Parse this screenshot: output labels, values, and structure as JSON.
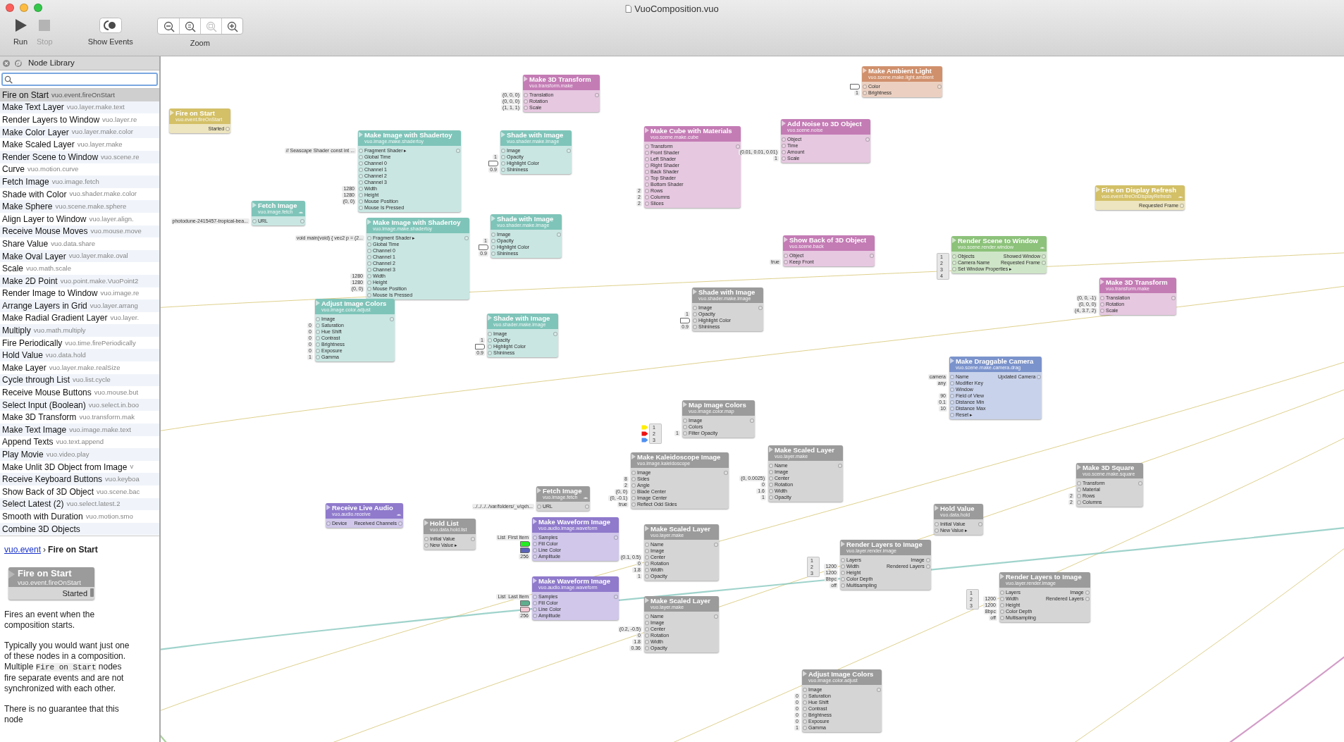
{
  "window": {
    "title": "VuoComposition.vuo"
  },
  "toolbar": {
    "buttons": [
      {
        "kind": "run",
        "label": "Run",
        "disabled": false
      },
      {
        "kind": "stop",
        "label": "Stop",
        "disabled": true
      },
      {
        "kind": "events",
        "label": "Show Events",
        "disabled": false
      }
    ],
    "zoom": {
      "label": "Zoom",
      "buttons": [
        {
          "kind": "out",
          "disabled": false
        },
        {
          "kind": "actual",
          "disabled": false
        },
        {
          "kind": "fit",
          "disabled": true
        },
        {
          "kind": "in",
          "disabled": false
        }
      ]
    }
  },
  "sidebar": {
    "title": "Node Library",
    "items": [
      {
        "name": "Fire on Start",
        "class": "vuo.event.fireOnStart",
        "selected": true
      },
      {
        "name": "Make Text Layer",
        "class": "vuo.layer.make.text",
        "selected": false
      },
      {
        "name": "Render Layers to Window",
        "class": "vuo.layer.re",
        "selected": false
      },
      {
        "name": "Make Color Layer",
        "class": "vuo.layer.make.color",
        "selected": false
      },
      {
        "name": "Make Scaled Layer",
        "class": "vuo.layer.make",
        "selected": false
      },
      {
        "name": "Render Scene to Window",
        "class": "vuo.scene.re",
        "selected": false
      },
      {
        "name": "Curve",
        "class": "vuo.motion.curve",
        "selected": false
      },
      {
        "name": "Fetch Image",
        "class": "vuo.image.fetch",
        "selected": false
      },
      {
        "name": "Shade with Color",
        "class": "vuo.shader.make.color",
        "selected": false
      },
      {
        "name": "Make Sphere",
        "class": "vuo.scene.make.sphere",
        "selected": false
      },
      {
        "name": "Align Layer to Window",
        "class": "vuo.layer.align.",
        "selected": false
      },
      {
        "name": "Receive Mouse Moves",
        "class": "vuo.mouse.move",
        "selected": false
      },
      {
        "name": "Share Value",
        "class": "vuo.data.share",
        "selected": false
      },
      {
        "name": "Make Oval Layer",
        "class": "vuo.layer.make.oval",
        "selected": false
      },
      {
        "name": "Scale",
        "class": "vuo.math.scale",
        "selected": false
      },
      {
        "name": "Make 2D Point",
        "class": "vuo.point.make.VuoPoint2",
        "selected": false
      },
      {
        "name": "Render Image to Window",
        "class": "vuo.image.re",
        "selected": false
      },
      {
        "name": "Arrange Layers in Grid",
        "class": "vuo.layer.arrang",
        "selected": false
      },
      {
        "name": "Make Radial Gradient Layer",
        "class": "vuo.layer.",
        "selected": false
      },
      {
        "name": "Multiply",
        "class": "vuo.math.multiply",
        "selected": false
      },
      {
        "name": "Fire Periodically",
        "class": "vuo.time.firePeriodically",
        "selected": false
      },
      {
        "name": "Hold Value",
        "class": "vuo.data.hold",
        "selected": false
      },
      {
        "name": "Make Layer",
        "class": "vuo.layer.make.realSize",
        "selected": false
      },
      {
        "name": "Cycle through List",
        "class": "vuo.list.cycle",
        "selected": false
      },
      {
        "name": "Receive Mouse Buttons",
        "class": "vuo.mouse.but",
        "selected": false
      },
      {
        "name": "Select Input (Boolean)",
        "class": "vuo.select.in.boo",
        "selected": false
      },
      {
        "name": "Make 3D Transform",
        "class": "vuo.transform.mak",
        "selected": false
      },
      {
        "name": "Make Text Image",
        "class": "vuo.image.make.text",
        "selected": false
      },
      {
        "name": "Append Texts",
        "class": "vuo.text.append",
        "selected": false
      },
      {
        "name": "Play Movie",
        "class": "vuo.video.play",
        "selected": false
      },
      {
        "name": "Make Unlit 3D Object from Image",
        "class": "v",
        "selected": false
      },
      {
        "name": "Receive Keyboard Buttons",
        "class": "vuo.keyboa",
        "selected": false
      },
      {
        "name": "Show Back of 3D Object",
        "class": "vuo.scene.bac",
        "selected": false
      },
      {
        "name": "Select Latest (2)",
        "class": "vuo.select.latest.2",
        "selected": false
      },
      {
        "name": "Smooth with Duration",
        "class": "vuo.motion.smo",
        "selected": false
      },
      {
        "name": "Combine 3D Objects",
        "selected": false
      }
    ]
  },
  "documentation": {
    "link": "vuo.event",
    "separator": "›",
    "current": "Fire on Start",
    "node": {
      "title": "Fire on Start",
      "class": "vuo.event.fireOnStart",
      "output": "Started"
    },
    "paragraphs": [
      [
        {
          "kind": "text",
          "text": "Fires an event when the composition starts."
        }
      ],
      [
        {
          "kind": "text",
          "text": "Typically you would want just one of these nodes in a composition. Multiple "
        },
        {
          "kind": "code",
          "text": "Fire on Start"
        },
        {
          "kind": "text",
          "text": " nodes fire separate events and are not synchronized with each other."
        }
      ],
      [
        {
          "kind": "text",
          "text": "There is no guarantee that this node"
        }
      ]
    ]
  },
  "canvas": {
    "nodes": [
      {
        "title": "Fire on Start",
        "class": "vuo.event.fireOnStart",
        "color": "#d3c067",
        "outputs": [
          "Started"
        ]
      },
      {
        "title": "Make 3D Transform",
        "class": "vuo.transform.make",
        "color": "#c47cb5",
        "inputs": [
          {
            "label": "Translation",
            "value": "(0, 0, 0)"
          },
          {
            "label": "Rotation",
            "value": "(0, 0, 0)"
          },
          {
            "label": "Scale",
            "value": "(1, 1, 1)"
          }
        ]
      },
      {
        "title": "Make Image with Shadertoy",
        "class": "vuo.image.make.shadertoy",
        "color": "#7fc4b9",
        "inputs": [
          {
            "label": "Fragment Shader ▸",
            "value": "// Seascape Shader const int ..."
          },
          {
            "label": "Global Time"
          },
          {
            "label": "Channel 0"
          },
          {
            "label": "Channel 1"
          },
          {
            "label": "Channel 2"
          },
          {
            "label": "Channel 3"
          },
          {
            "label": "Width",
            "value": "1280"
          },
          {
            "label": "Height",
            "value": "1280"
          },
          {
            "label": "Mouse Position",
            "value": "(0, 0)"
          },
          {
            "label": "Mouse Is Pressed"
          }
        ]
      },
      {
        "title": "Shade with Image",
        "class": "vuo.shader.make.image",
        "color": "#7fc4b9",
        "inputs": [
          {
            "label": "Image"
          },
          {
            "label": "Opacity",
            "value": "1"
          },
          {
            "label": "Highlight Color",
            "color": "#ffffff"
          },
          {
            "label": "Shininess",
            "value": "0.9"
          }
        ]
      },
      {
        "title": "Fetch Image",
        "class": "vuo.image.fetch",
        "color": "#7fc4b9",
        "fires": true,
        "inputs": [
          {
            "label": "URL",
            "value": "photodune-2415457-tropical-bea..."
          }
        ]
      },
      {
        "title": "Make Image with Shadertoy",
        "class": "vuo.image.make.shadertoy",
        "color": "#7fc4b9",
        "inputs": [
          {
            "label": "Fragment Shader ▸",
            "value": "void main(void) { vec2 p = (2..."
          },
          {
            "label": "Global Time"
          },
          {
            "label": "Channel 0"
          },
          {
            "label": "Channel 1"
          },
          {
            "label": "Channel 2"
          },
          {
            "label": "Channel 3"
          },
          {
            "label": "Width",
            "value": "1280"
          },
          {
            "label": "Height",
            "value": "1280"
          },
          {
            "label": "Mouse Position",
            "value": "(0, 0)"
          },
          {
            "label": "Mouse Is Pressed"
          }
        ]
      },
      {
        "title": "Shade with Image",
        "class": "vuo.shader.make.image",
        "color": "#7fc4b9",
        "inputs": [
          {
            "label": "Image"
          },
          {
            "label": "Opacity",
            "value": "1"
          },
          {
            "label": "Highlight Color",
            "color": "#ffffff"
          },
          {
            "label": "Shininess",
            "value": "0.9"
          }
        ]
      },
      {
        "title": "Adjust Image Colors",
        "class": "vuo.image.color.adjust",
        "color": "#7fc4b9",
        "inputs": [
          {
            "label": "Image"
          },
          {
            "label": "Saturation",
            "value": "0"
          },
          {
            "label": "Hue Shift",
            "value": "0"
          },
          {
            "label": "Contrast",
            "value": "0"
          },
          {
            "label": "Brightness",
            "value": "0"
          },
          {
            "label": "Exposure",
            "value": "0"
          },
          {
            "label": "Gamma",
            "value": "1"
          }
        ]
      },
      {
        "title": "Shade with Image",
        "class": "vuo.shader.make.image",
        "color": "#7fc4b9",
        "inputs": [
          {
            "label": "Image"
          },
          {
            "label": "Opacity",
            "value": "1"
          },
          {
            "label": "Highlight Color",
            "color": "#ffffff"
          },
          {
            "label": "Shininess",
            "value": "0.9"
          }
        ]
      },
      {
        "title": "Make Ambient Light",
        "class": "vuo.scene.make.light.ambient",
        "color": "#d0906c",
        "inputs": [
          {
            "label": "Color",
            "color": "#ffffff"
          },
          {
            "label": "Brightness",
            "value": "1"
          }
        ]
      },
      {
        "title": "Make Cube with Materials",
        "class": "vuo.scene.make.cube",
        "color": "#c47cb5",
        "inputs": [
          {
            "label": "Transform"
          },
          {
            "label": "Front Shader"
          },
          {
            "label": "Left Shader"
          },
          {
            "label": "Right Shader"
          },
          {
            "label": "Back Shader"
          },
          {
            "label": "Top Shader"
          },
          {
            "label": "Bottom Shader"
          },
          {
            "label": "Rows",
            "value": "2"
          },
          {
            "label": "Columns",
            "value": "2"
          },
          {
            "label": "Slices",
            "value": "2"
          }
        ]
      },
      {
        "title": "Add Noise to 3D Object",
        "class": "vuo.scene.noise",
        "color": "#c47cb5",
        "inputs": [
          {
            "label": "Object"
          },
          {
            "label": "Time"
          },
          {
            "label": "Amount",
            "value": "(0.01, 0.01, 0.01)"
          },
          {
            "label": "Scale",
            "value": "1"
          }
        ]
      },
      {
        "title": "Fire on Display Refresh",
        "class": "vuo.event.fireOnDisplayRefresh",
        "color": "#d3c067",
        "fires": true,
        "outputs": [
          "Requested Frame"
        ]
      },
      {
        "title": "Show Back of 3D Object",
        "class": "vuo.scene.back",
        "color": "#c47cb5",
        "inputs": [
          {
            "label": "Object"
          },
          {
            "label": "Keep Front",
            "value": "true"
          }
        ]
      },
      {
        "title": "Render Scene to Window",
        "class": "vuo.scene.render.window",
        "color": "#8cc27a",
        "fires": true,
        "inputs": [
          {
            "label": "Objects",
            "list": [
              {
                "label": "1"
              },
              {
                "label": "2"
              },
              {
                "label": "3"
              },
              {
                "label": "4"
              }
            ]
          },
          {
            "label": "Camera Name"
          },
          {
            "label": "Set Window Properties ▸"
          }
        ],
        "outputs": [
          "Showed Window",
          "Requested Frame"
        ]
      },
      {
        "title": "Make 3D Transform",
        "class": "vuo.transform.make",
        "color": "#c47cb5",
        "inputs": [
          {
            "label": "Translation",
            "value": "(0, 0, -1)"
          },
          {
            "label": "Rotation",
            "value": "(0, 0, 0)"
          },
          {
            "label": "Scale",
            "value": "(4, 3.7, 2)"
          }
        ]
      },
      {
        "title": "Shade with Image",
        "class": "vuo.shader.make.image",
        "color": "#9b9b9b",
        "inputs": [
          {
            "label": "Image"
          },
          {
            "label": "Opacity",
            "value": "1"
          },
          {
            "label": "Highlight Color",
            "color": "#ffffff"
          },
          {
            "label": "Shininess",
            "value": "0.9"
          }
        ]
      },
      {
        "title": "Make Draggable Camera",
        "class": "vuo.scene.make.camera.drag",
        "color": "#7b93cc",
        "inputs": [
          {
            "label": "Name",
            "value": "camera"
          },
          {
            "label": "Modifier Key",
            "value": "any"
          },
          {
            "label": "Window"
          },
          {
            "label": "Field of View",
            "value": "90"
          },
          {
            "label": "Distance Min",
            "value": "0.1"
          },
          {
            "label": "Distance Max",
            "value": "10"
          },
          {
            "label": "Reset ▸"
          }
        ],
        "outputs": [
          "Updated Camera"
        ]
      },
      {
        "title": "Map Image Colors",
        "class": "vuo.image.color.map",
        "color": "#9b9b9b",
        "inputs": [
          {
            "label": "Image"
          },
          {
            "label": "Colors",
            "list": [
              {
                "label": "1",
                "color": "#ffee00"
              },
              {
                "label": "2",
                "color": "#ee1111"
              },
              {
                "label": "3",
                "color": "#4f8ff0"
              }
            ]
          },
          {
            "label": "Filter Opacity",
            "value": "1"
          }
        ]
      },
      {
        "title": "Make Kaleidoscope Image",
        "class": "vuo.image.kaleidoscope",
        "color": "#9b9b9b",
        "inputs": [
          {
            "label": "Image"
          },
          {
            "label": "Sides",
            "value": "8"
          },
          {
            "label": "Angle",
            "value": "2"
          },
          {
            "label": "Blade Center",
            "value": "(0, 0)"
          },
          {
            "label": "Image Center",
            "value": "(0, -0.1)"
          },
          {
            "label": "Reflect Odd Sides",
            "value": "true"
          }
        ]
      },
      {
        "title": "Make Scaled Layer",
        "class": "vuo.layer.make",
        "color": "#9b9b9b",
        "inputs": [
          {
            "label": "Name"
          },
          {
            "label": "Image"
          },
          {
            "label": "Center",
            "value": "(0, 0.0025)"
          },
          {
            "label": "Rotation",
            "value": "0"
          },
          {
            "label": "Width",
            "value": "1.6"
          },
          {
            "label": "Opacity",
            "value": "1"
          }
        ]
      },
      {
        "title": "Make 3D Square",
        "class": "vuo.scene.make.square",
        "color": "#9b9b9b",
        "inputs": [
          {
            "label": "Transform"
          },
          {
            "label": "Material"
          },
          {
            "label": "Rows",
            "value": "2"
          },
          {
            "label": "Columns",
            "value": "2"
          }
        ]
      },
      {
        "title": "Receive Live Audio",
        "class": "vuo.audio.receive",
        "color": "#8f7acc",
        "fires": true,
        "inputs": [
          {
            "label": "Device"
          }
        ],
        "outputs": [
          "Received Channels"
        ]
      },
      {
        "title": "Fetch Image",
        "class": "vuo.image.fetch",
        "color": "#9b9b9b",
        "fires": true,
        "inputs": [
          {
            "label": "URL",
            "value": "../../../../var/folders/_v/qxh..."
          }
        ]
      },
      {
        "title": "Hold List",
        "class": "vuo.data.hold.list",
        "color": "#9b9b9b",
        "inputs": [
          {
            "label": "Initial Value"
          },
          {
            "label": "New Value ▸"
          }
        ]
      },
      {
        "title": "Make Waveform Image",
        "class": "vuo.audio.image.waveform",
        "color": "#8f7acc",
        "inputs": [
          {
            "label": "Samples",
            "value": "List  First Item"
          },
          {
            "label": "Fill Color",
            "color": "#22ee22"
          },
          {
            "label": "Line Color",
            "color": "#5a63b8"
          },
          {
            "label": "Amplitude",
            "value": "256"
          }
        ]
      },
      {
        "title": "Make Scaled Layer",
        "class": "vuo.layer.make",
        "color": "#9b9b9b",
        "inputs": [
          {
            "label": "Name"
          },
          {
            "label": "Image"
          },
          {
            "label": "Center",
            "value": "(0.1, 0.5)"
          },
          {
            "label": "Rotation",
            "value": "0"
          },
          {
            "label": "Width",
            "value": "1.8"
          },
          {
            "label": "Opacity",
            "value": "1"
          }
        ]
      },
      {
        "title": "Hold Value",
        "class": "vuo.data.hold",
        "color": "#9b9b9b",
        "inputs": [
          {
            "label": "Initial Value"
          },
          {
            "label": "New Value ▸"
          }
        ]
      },
      {
        "title": "Render Layers to Image",
        "class": "vuo.layer.render.image",
        "color": "#9b9b9b",
        "inputs": [
          {
            "label": "Layers",
            "list": [
              {
                "label": "1"
              },
              {
                "label": "2"
              },
              {
                "label": "3"
              }
            ]
          },
          {
            "label": "Width",
            "value": "1200"
          },
          {
            "label": "Height",
            "value": "1200"
          },
          {
            "label": "Color Depth",
            "value": "8bpc"
          },
          {
            "label": "Multisampling",
            "value": "off"
          }
        ],
        "outputs": [
          "Image",
          "Rendered Layers"
        ]
      },
      {
        "title": "Make Waveform Image",
        "class": "vuo.audio.image.waveform",
        "color": "#8f7acc",
        "inputs": [
          {
            "label": "Samples",
            "value": "List  Last Item"
          },
          {
            "label": "Fill Color",
            "color": "#5fae8e"
          },
          {
            "label": "Line Color",
            "color": "#f4c9d4"
          },
          {
            "label": "Amplitude",
            "value": "256"
          }
        ]
      },
      {
        "title": "Render Layers to Image",
        "class": "vuo.layer.render.image",
        "color": "#9b9b9b",
        "inputs": [
          {
            "label": "Layers",
            "list": [
              {
                "label": "1"
              },
              {
                "label": "2"
              },
              {
                "label": "3"
              }
            ]
          },
          {
            "label": "Width",
            "value": "1200"
          },
          {
            "label": "Height",
            "value": "1200"
          },
          {
            "label": "Color Depth",
            "value": "8bpc"
          },
          {
            "label": "Multisampling",
            "value": "off"
          }
        ],
        "outputs": [
          "Image",
          "Rendered Layers"
        ]
      },
      {
        "title": "Make Scaled Layer",
        "class": "vuo.layer.make",
        "color": "#9b9b9b",
        "inputs": [
          {
            "label": "Name"
          },
          {
            "label": "Image"
          },
          {
            "label": "Center",
            "value": "(0.2, -0.5)"
          },
          {
            "label": "Rotation",
            "value": "0"
          },
          {
            "label": "Width",
            "value": "1.8"
          },
          {
            "label": "Opacity",
            "value": "0.36"
          }
        ]
      },
      {
        "title": "Adjust Image Colors",
        "class": "vuo.image.color.adjust",
        "color": "#9b9b9b",
        "inputs": [
          {
            "label": "Image"
          },
          {
            "label": "Saturation",
            "value": "0"
          },
          {
            "label": "Hue Shift",
            "value": "0"
          },
          {
            "label": "Contrast",
            "value": "0"
          },
          {
            "label": "Brightness",
            "value": "0"
          },
          {
            "label": "Exposure",
            "value": "0"
          },
          {
            "label": "Gamma",
            "value": "1"
          }
        ]
      }
    ]
  }
}
